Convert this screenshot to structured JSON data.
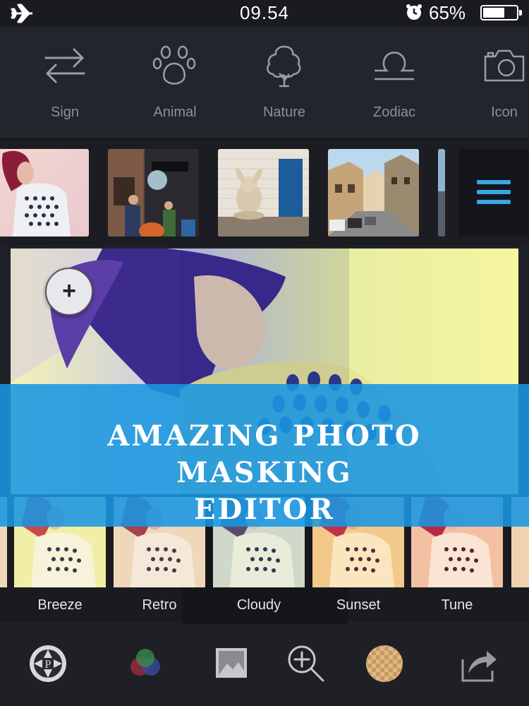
{
  "status_bar": {
    "time": "09.54",
    "battery": "65%"
  },
  "categories": [
    {
      "label": "Sign",
      "icon": "arrows-swap-icon"
    },
    {
      "label": "Animal",
      "icon": "paw-icon"
    },
    {
      "label": "Nature",
      "icon": "tree-icon"
    },
    {
      "label": "Zodiac",
      "icon": "libra-icon"
    },
    {
      "label": "Icon",
      "icon": "camera-icon"
    }
  ],
  "banner": {
    "line1": "AMAZING PHOTO MASKING",
    "line2": "EDITOR"
  },
  "filters": [
    {
      "label": "Breeze"
    },
    {
      "label": "Retro"
    },
    {
      "label": "Cloudy"
    },
    {
      "label": "Sunset"
    },
    {
      "label": "Tune"
    }
  ],
  "selected_filter": "Cloudy",
  "colors": {
    "accent": "#3aa7e4",
    "banner": "#1996e1",
    "background": "#1f2128"
  }
}
